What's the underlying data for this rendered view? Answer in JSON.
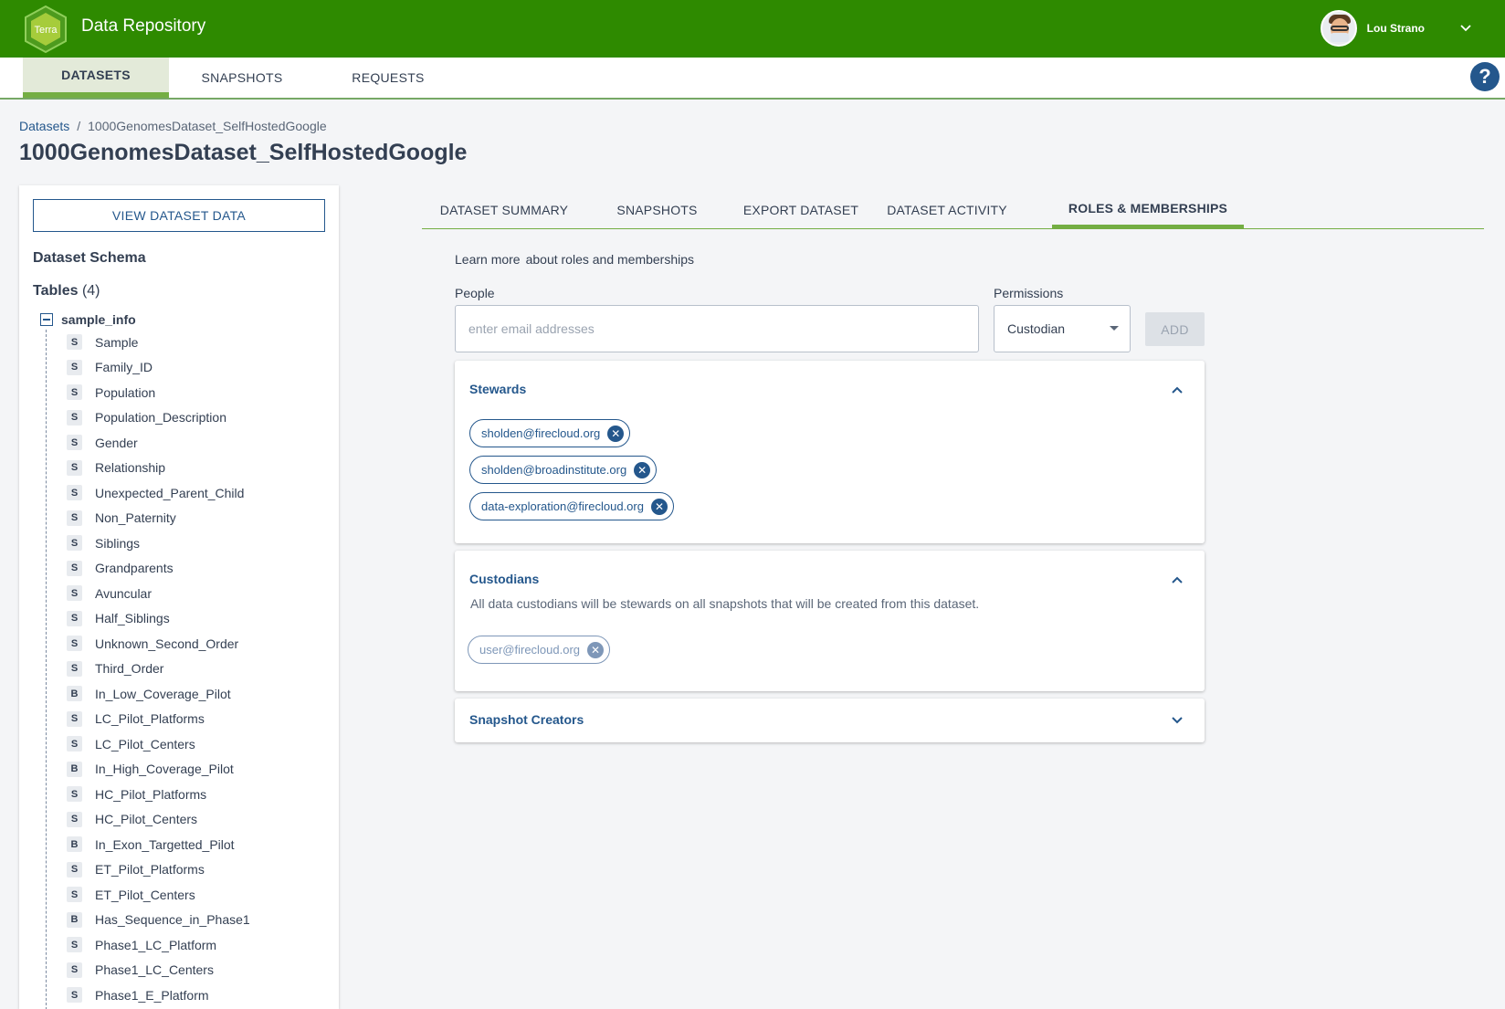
{
  "header": {
    "logo_text": "Terra",
    "app_title": "Data Repository",
    "user_name": "Lou Strano"
  },
  "main_nav": {
    "tabs": [
      {
        "label": "DATASETS",
        "active": true
      },
      {
        "label": "SNAPSHOTS",
        "active": false
      },
      {
        "label": "REQUESTS",
        "active": false
      }
    ],
    "help_label": "?"
  },
  "breadcrumb": {
    "parent": "Datasets",
    "separator": "/",
    "current": "1000GenomesDataset_SelfHostedGoogle"
  },
  "page_title": "1000GenomesDataset_SelfHostedGoogle",
  "sidebar": {
    "view_data_label": "VIEW DATASET DATA",
    "schema_title": "Dataset Schema",
    "tables_label": "Tables",
    "tables_count": "(4)",
    "table_name": "sample_info",
    "columns": [
      {
        "type": "S",
        "name": "Sample"
      },
      {
        "type": "S",
        "name": "Family_ID"
      },
      {
        "type": "S",
        "name": "Population"
      },
      {
        "type": "S",
        "name": "Population_Description"
      },
      {
        "type": "S",
        "name": "Gender"
      },
      {
        "type": "S",
        "name": "Relationship"
      },
      {
        "type": "S",
        "name": "Unexpected_Parent_Child"
      },
      {
        "type": "S",
        "name": "Non_Paternity"
      },
      {
        "type": "S",
        "name": "Siblings"
      },
      {
        "type": "S",
        "name": "Grandparents"
      },
      {
        "type": "S",
        "name": "Avuncular"
      },
      {
        "type": "S",
        "name": "Half_Siblings"
      },
      {
        "type": "S",
        "name": "Unknown_Second_Order"
      },
      {
        "type": "S",
        "name": "Third_Order"
      },
      {
        "type": "B",
        "name": "In_Low_Coverage_Pilot"
      },
      {
        "type": "S",
        "name": "LC_Pilot_Platforms"
      },
      {
        "type": "S",
        "name": "LC_Pilot_Centers"
      },
      {
        "type": "B",
        "name": "In_High_Coverage_Pilot"
      },
      {
        "type": "S",
        "name": "HC_Pilot_Platforms"
      },
      {
        "type": "S",
        "name": "HC_Pilot_Centers"
      },
      {
        "type": "B",
        "name": "In_Exon_Targetted_Pilot"
      },
      {
        "type": "S",
        "name": "ET_Pilot_Platforms"
      },
      {
        "type": "S",
        "name": "ET_Pilot_Centers"
      },
      {
        "type": "B",
        "name": "Has_Sequence_in_Phase1"
      },
      {
        "type": "S",
        "name": "Phase1_LC_Platform"
      },
      {
        "type": "S",
        "name": "Phase1_LC_Centers"
      },
      {
        "type": "S",
        "name": "Phase1_E_Platform"
      }
    ]
  },
  "content_tabs": [
    {
      "label": "DATASET SUMMARY",
      "active": false
    },
    {
      "label": "SNAPSHOTS",
      "active": false
    },
    {
      "label": "EXPORT DATASET",
      "active": false
    },
    {
      "label": "DATASET ACTIVITY",
      "active": false
    },
    {
      "label": "ROLES & MEMBERSHIPS",
      "active": true
    }
  ],
  "roles": {
    "learn_more_link": "Learn more",
    "learn_more_text": "about roles and memberships",
    "people_label": "People",
    "people_placeholder": "enter email addresses",
    "permissions_label": "Permissions",
    "permission_value": "Custodian",
    "add_label": "ADD"
  },
  "panels": {
    "stewards": {
      "title": "Stewards",
      "members": [
        "sholden@firecloud.org",
        "sholden@broadinstitute.org",
        "data-exploration@firecloud.org"
      ]
    },
    "custodians": {
      "title": "Custodians",
      "description": "All data custodians will be stewards on all snapshots that will be created from this dataset.",
      "members": [
        "user@firecloud.org"
      ]
    },
    "snapshot_creators": {
      "title": "Snapshot Creators"
    }
  },
  "colors": {
    "header_green": "#2e8a00",
    "accent_green": "#74ae43",
    "link_blue": "#24578c",
    "text_dark": "#333f52"
  }
}
